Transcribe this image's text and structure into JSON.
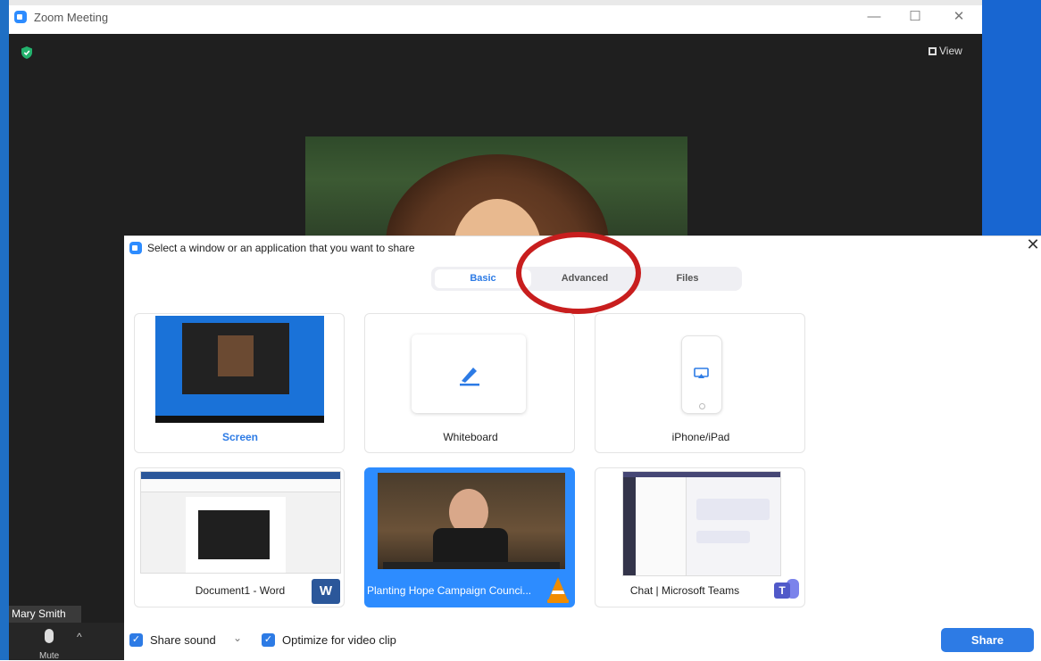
{
  "window": {
    "title": "Zoom Meeting",
    "view_label": "View",
    "participant_name": "Mary Smith",
    "mute_label": "Mute",
    "controls": [
      "—",
      "☐",
      "✕"
    ]
  },
  "dialog": {
    "title": "Select a window or an application that you want to share",
    "close": "✕",
    "tabs": [
      {
        "label": "Basic",
        "active": true
      },
      {
        "label": "Advanced",
        "active": false
      },
      {
        "label": "Files",
        "active": false
      }
    ],
    "items": [
      {
        "label": "Screen",
        "selected": false,
        "label_color": "#2d7be5"
      },
      {
        "label": "Whiteboard",
        "selected": false
      },
      {
        "label": "iPhone/iPad",
        "selected": false
      },
      {
        "label": "Document1 - Word",
        "selected": false,
        "app_icon": "word-icon"
      },
      {
        "label": "Planting Hope Campaign Counci...",
        "selected": true,
        "app_icon": "vlc-icon"
      },
      {
        "label": "Chat | Microsoft Teams",
        "selected": false,
        "app_icon": "teams-icon"
      }
    ],
    "share_sound_label": "Share sound",
    "optimize_label": "Optimize for video clip",
    "share_button": "Share"
  },
  "colors": {
    "accent": "#2d7be5",
    "highlight_circle": "#c81e1e",
    "meeting_bg": "#1f1f1f"
  }
}
